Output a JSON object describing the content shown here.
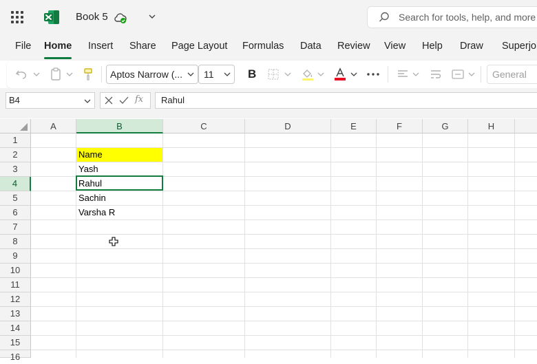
{
  "app": {
    "title": "Book 5",
    "search_placeholder": "Search for tools, help, and more"
  },
  "tabs": [
    {
      "label": "File"
    },
    {
      "label": "Home"
    },
    {
      "label": "Insert"
    },
    {
      "label": "Share"
    },
    {
      "label": "Page Layout"
    },
    {
      "label": "Formulas"
    },
    {
      "label": "Data"
    },
    {
      "label": "Review"
    },
    {
      "label": "View"
    },
    {
      "label": "Help"
    },
    {
      "label": "Draw"
    },
    {
      "label": "Superjoin"
    }
  ],
  "active_tab": "Home",
  "ribbon": {
    "font_name": "Aptos Narrow (...",
    "font_size": "11",
    "bold_label": "B",
    "number_format": "General"
  },
  "formula_bar": {
    "name_box": "B4",
    "formula": "Rahul",
    "fx_label": "fx"
  },
  "grid": {
    "columns": [
      "A",
      "B",
      "C",
      "D",
      "E",
      "F",
      "G",
      "H"
    ],
    "rows": [
      "1",
      "2",
      "3",
      "4",
      "5",
      "6",
      "7",
      "8",
      "9",
      "10",
      "11",
      "12",
      "13",
      "14",
      "15",
      "16"
    ],
    "selected_column": "B",
    "selected_row": "4",
    "cells": {
      "B2": "Name",
      "B3": "Yash",
      "B4": "Rahul",
      "B5": "Sachin",
      "B6": "Varsha R"
    }
  },
  "colors": {
    "accent": "#137c3f",
    "header_fill": "#ffff00",
    "excel_green": "#107c41"
  }
}
